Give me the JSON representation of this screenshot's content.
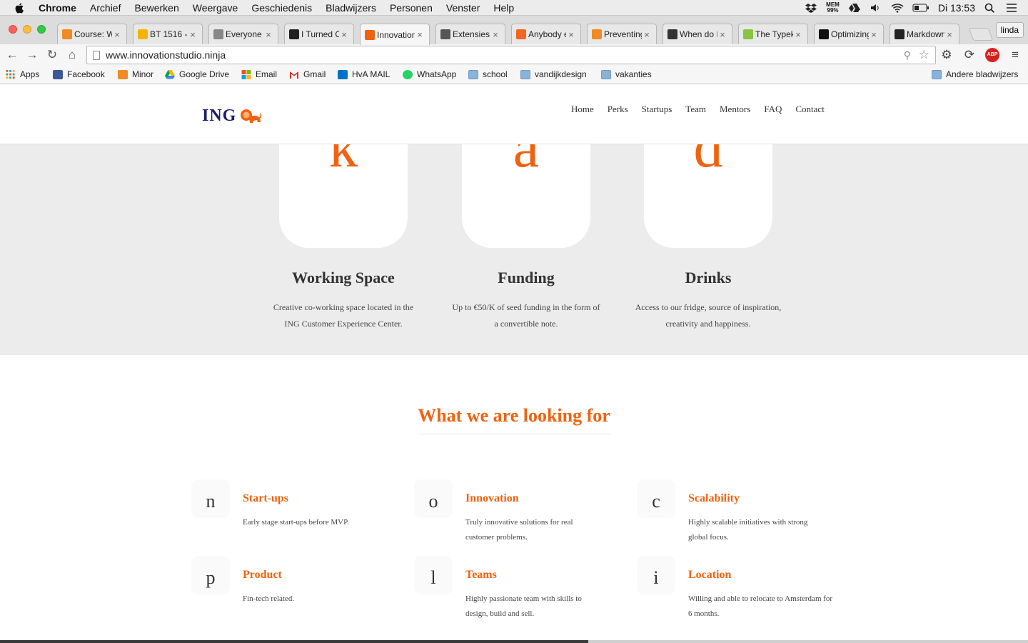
{
  "menubar": {
    "app": "Chrome",
    "items": [
      "Archief",
      "Bewerken",
      "Weergave",
      "Geschiedenis",
      "Bladwijzers",
      "Personen",
      "Venster",
      "Help"
    ],
    "mem_label": "MEM",
    "mem_value": "99%",
    "clock": "Di 13:53"
  },
  "tabs": [
    {
      "title": "Course: W",
      "icon": "minor-icon",
      "color": "#f08a24"
    },
    {
      "title": "BT 1516 -",
      "icon": "slides-icon",
      "color": "#f4b400"
    },
    {
      "title": "Everyone l",
      "icon": "page-icon",
      "color": "#888888"
    },
    {
      "title": "I Turned O",
      "icon": "medium-icon",
      "color": "#222222"
    },
    {
      "title": "Innovation",
      "icon": "ing-icon",
      "color": "#f0620f",
      "active": true
    },
    {
      "title": "Extensies",
      "icon": "puzzle-icon",
      "color": "#555555"
    },
    {
      "title": "Anybody e",
      "icon": "ycombinator-icon",
      "color": "#f26522"
    },
    {
      "title": "Preventing",
      "icon": "asterisk-icon",
      "color": "#f08a24"
    },
    {
      "title": "When do I",
      "icon": "codepen-icon",
      "color": "#333333"
    },
    {
      "title": "The Typek",
      "icon": "typekit-icon",
      "color": "#87c440"
    },
    {
      "title": "Optimizing",
      "icon": "ig-icon",
      "color": "#111111"
    },
    {
      "title": "Markdown",
      "icon": "github-icon",
      "color": "#222222"
    }
  ],
  "profile": "linda",
  "address": {
    "url": "www.innovationstudio.ninja"
  },
  "bookmarks": [
    {
      "label": "Apps",
      "icon": "apps-grid-icon"
    },
    {
      "label": "Facebook",
      "icon": "facebook-icon"
    },
    {
      "label": "Minor",
      "icon": "minor-icon"
    },
    {
      "label": "Google Drive",
      "icon": "google-drive-icon"
    },
    {
      "label": "Email",
      "icon": "microsoft-icon"
    },
    {
      "label": "Gmail",
      "icon": "gmail-icon"
    },
    {
      "label": "HvA MAIL",
      "icon": "outlook-icon"
    },
    {
      "label": "WhatsApp",
      "icon": "whatsapp-icon"
    },
    {
      "label": "school",
      "icon": "folder-icon"
    },
    {
      "label": "vandijkdesign",
      "icon": "folder-icon"
    },
    {
      "label": "vakanties",
      "icon": "folder-icon"
    },
    {
      "label": "Andere bladwijzers",
      "icon": "folder-icon"
    }
  ],
  "site": {
    "logo_text": "ING",
    "nav": [
      "Home",
      "Perks",
      "Startups",
      "Team",
      "Mentors",
      "FAQ",
      "Contact"
    ],
    "accent": "#f0620f",
    "perks": [
      {
        "letter": "k",
        "title": "Working Space",
        "desc1": "Creative co-working space located in the",
        "desc2": "ING Customer Experience Center."
      },
      {
        "letter": "a",
        "title": "Funding",
        "desc1": "Up to €50/K of seed funding in the form of",
        "desc2": "a convertible note."
      },
      {
        "letter": "d",
        "title": "Drinks",
        "desc1": "Access to our fridge, source of inspiration,",
        "desc2": "creativity and happiness."
      }
    ],
    "looking_heading": "What we are looking for",
    "features": [
      {
        "letter": "n",
        "title": "Start-ups",
        "desc": "Early stage start-ups before MVP."
      },
      {
        "letter": "o",
        "title": "Innovation",
        "desc": "Truly innovative solutions for real customer problems."
      },
      {
        "letter": "c",
        "title": "Scalability",
        "desc": "Highly scalable initiatives with strong global focus."
      },
      {
        "letter": "p",
        "title": "Product",
        "desc": "Fin-tech related."
      },
      {
        "letter": "l",
        "title": "Teams",
        "desc": "Highly passionate team with skills to design, build and sell."
      },
      {
        "letter": "i",
        "title": "Location",
        "desc": "Willing and able to relocate to Amsterdam for 6 months."
      }
    ]
  }
}
